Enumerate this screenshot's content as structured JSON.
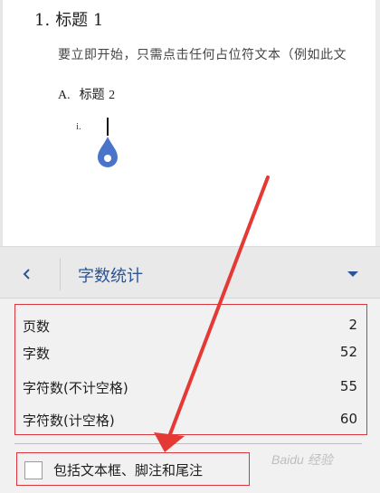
{
  "document": {
    "heading1": {
      "number": "1.",
      "text": "标题",
      "num_suffix": "1"
    },
    "paragraph": "要立即开始，只需点击任何占位符文本（例如此文",
    "heading2": {
      "marker": "A.",
      "text": "标题",
      "num_suffix": "2"
    },
    "heading3": {
      "marker": "i."
    }
  },
  "panel": {
    "title": "字数统计",
    "stats": [
      {
        "label": "页数",
        "value": "2"
      },
      {
        "label": "字数",
        "value": "52"
      },
      {
        "label": "字符数(不计空格)",
        "value": "55"
      },
      {
        "label": "字符数(计空格)",
        "value": "60"
      }
    ],
    "include_label": "包括文本框、脚注和尾注"
  },
  "watermark": "Baidu 经验",
  "colors": {
    "accent": "#2a5598",
    "highlight": "#d9363e",
    "cursor_handle": "#4a74c9"
  }
}
